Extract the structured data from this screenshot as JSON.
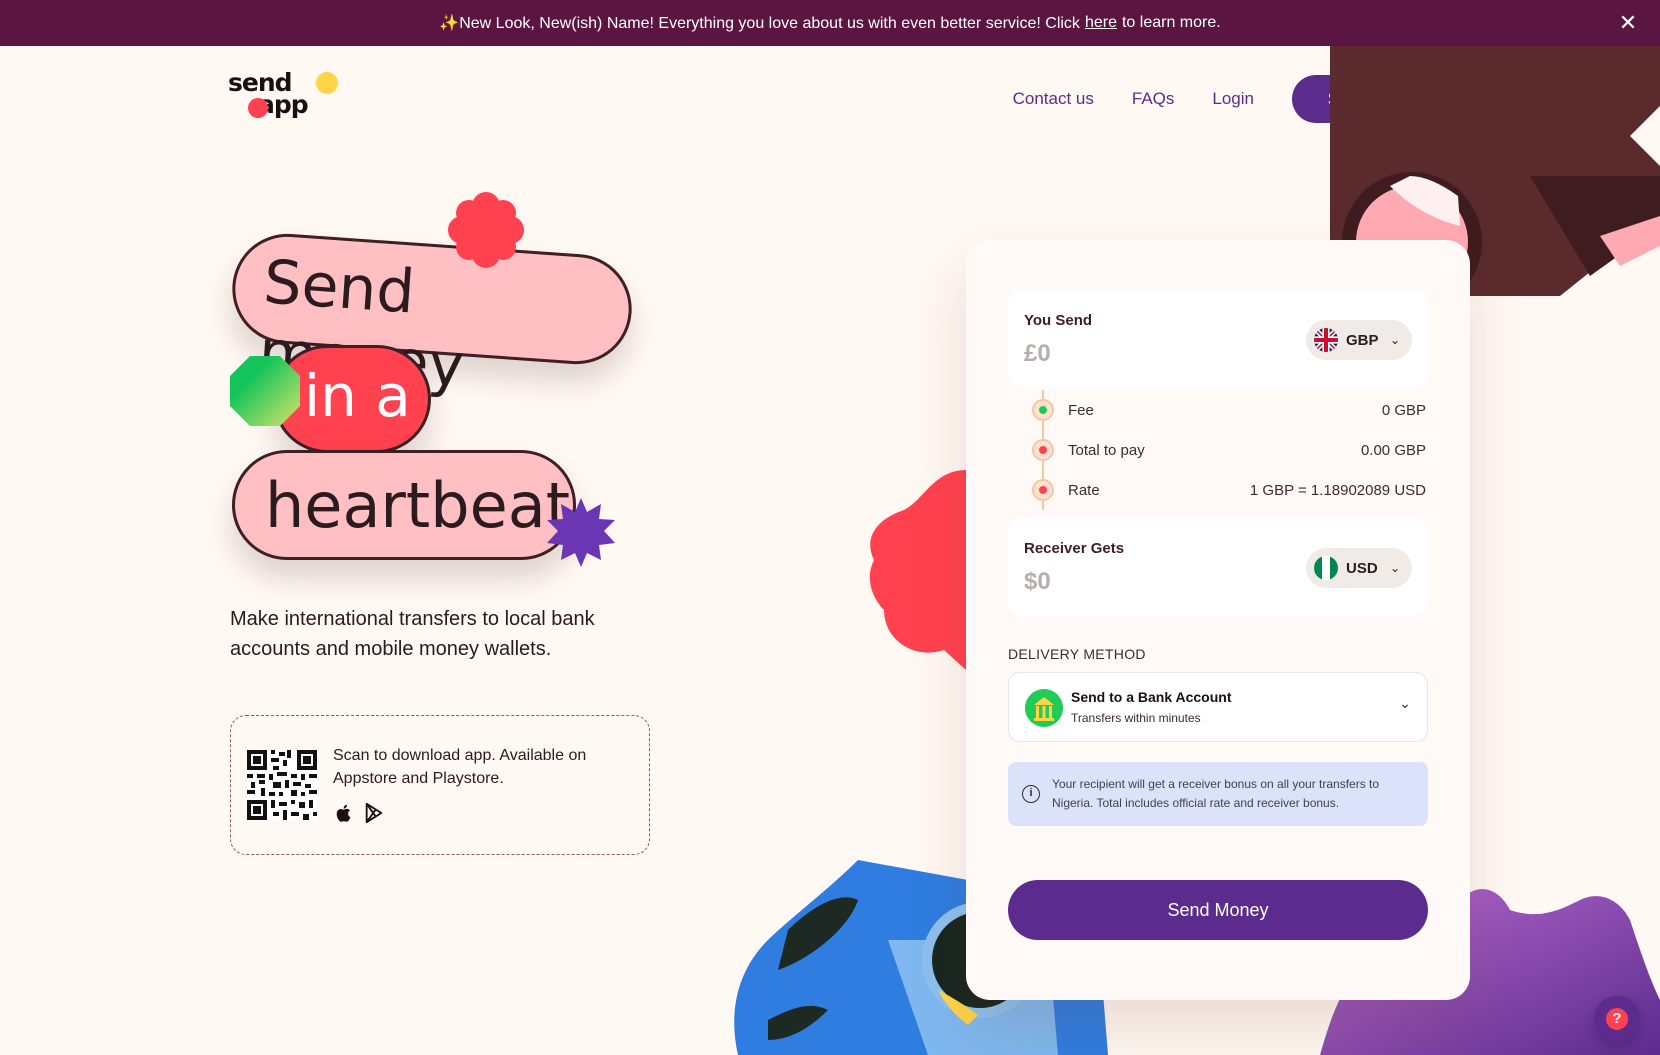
{
  "banner": {
    "text_before": "✨New Look, New(ish) Name! Everything you love about us with even better service! Click",
    "link": "here",
    "text_after": "to learn more."
  },
  "logo": {
    "line1": "send",
    "line2": "app"
  },
  "nav": {
    "contact": "Contact us",
    "faqs": "FAQs",
    "login": "Login",
    "signup": "Sign up"
  },
  "hero": {
    "line1": "Send money",
    "line2": "in a",
    "line3": "heartbeat",
    "subhead": "Make international transfers to local bank accounts and mobile money wallets."
  },
  "qr": {
    "text": "Scan to download app. Available on Appstore and Playstore."
  },
  "calculator": {
    "you_send": {
      "label": "You Send",
      "amount": "£0",
      "currency": "GBP"
    },
    "fee": {
      "label": "Fee",
      "value": "0 GBP"
    },
    "total": {
      "label": "Total to pay",
      "value": "0.00 GBP"
    },
    "rate": {
      "label": "Rate",
      "value": "1 GBP = 1.18902089 USD"
    },
    "receiver_gets": {
      "label": "Receiver Gets",
      "amount": "$0",
      "currency": "USD"
    },
    "delivery_label": "DELIVERY METHOD",
    "delivery": {
      "title": "Send to a Bank Account",
      "subtitle": "Transfers within minutes"
    },
    "info": "Your recipient will get a receiver bonus on all your transfers to Nigeria. Total includes official rate and receiver bonus.",
    "send_button": "Send Money"
  },
  "colors": {
    "banner": "#5a1540",
    "brand_purple": "#5b2c8d",
    "pink": "#ffbfc3",
    "red": "#ff4150",
    "green": "#1fcc56",
    "yellow": "#ffd447",
    "blue": "#2f7de1"
  },
  "icons": [
    "close-icon",
    "apple-icon",
    "play-store-icon",
    "info-icon",
    "chevron-down-icon",
    "help-icon"
  ]
}
